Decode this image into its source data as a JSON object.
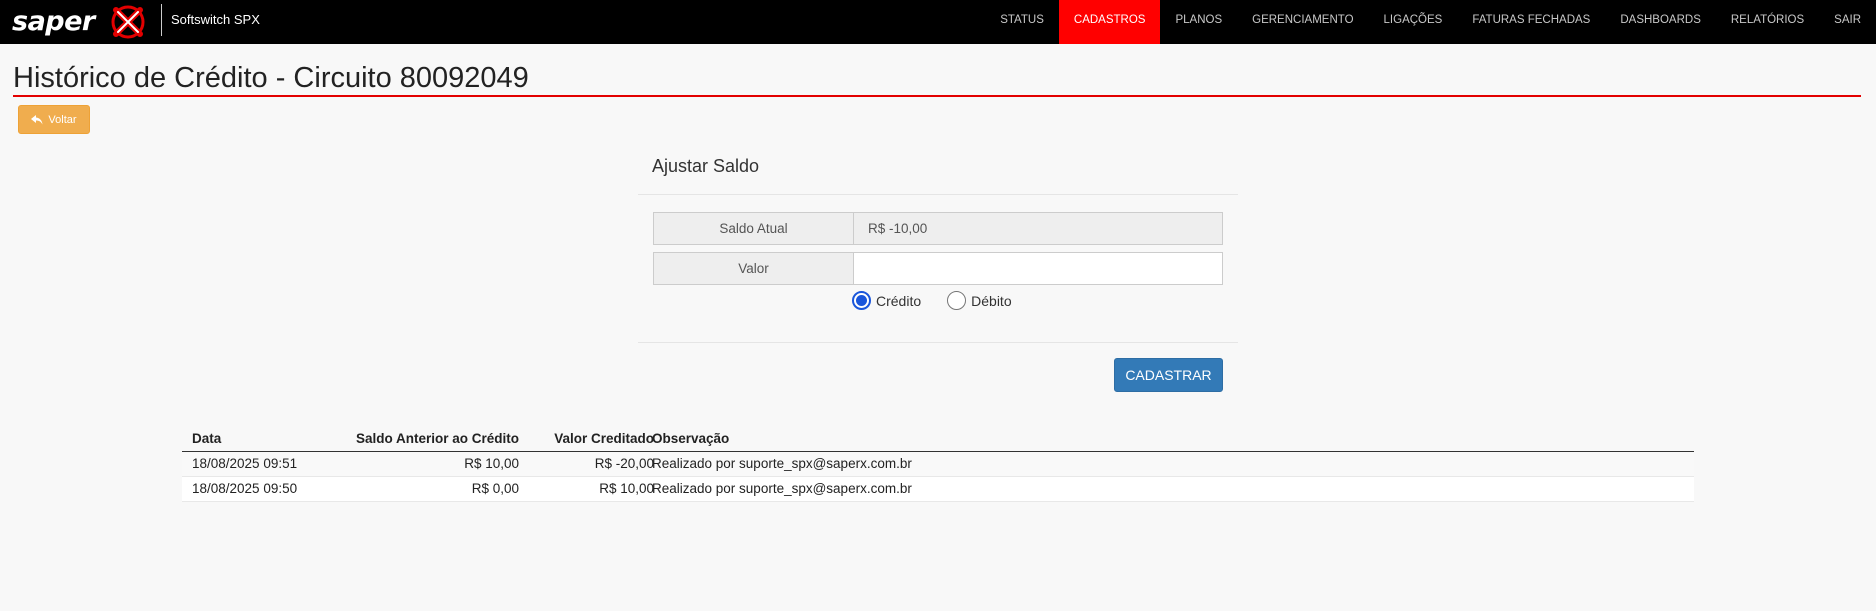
{
  "brand": {
    "logo_text": "saper",
    "subtitle": "Softswitch SPX",
    "accent_color": "#e30000"
  },
  "nav": {
    "items": [
      {
        "label": "STATUS",
        "active": false
      },
      {
        "label": "CADASTROS",
        "active": true
      },
      {
        "label": "PLANOS",
        "active": false
      },
      {
        "label": "GERENCIAMENTO",
        "active": false
      },
      {
        "label": "LIGAÇÕES",
        "active": false
      },
      {
        "label": "FATURAS FECHADAS",
        "active": false
      },
      {
        "label": "DASHBOARDS",
        "active": false
      },
      {
        "label": "RELATÓRIOS",
        "active": false
      },
      {
        "label": "SAIR",
        "active": false
      }
    ],
    "active_color": "#ff0000"
  },
  "page": {
    "title": "Histórico de Crédito - Circuito 80092049",
    "back_label": "Voltar",
    "back_icon": "reply-icon"
  },
  "form": {
    "title": "Ajustar Saldo",
    "balance_label": "Saldo Atual",
    "balance_value": "R$ -10,00",
    "amount_label": "Valor",
    "amount_value": "",
    "radio_credit": "Crédito",
    "radio_debit": "Débito",
    "selected": "credit",
    "submit_label": "CADASTRAR"
  },
  "history": {
    "columns": [
      "Data",
      "Saldo Anterior ao Crédito",
      "Valor Creditado",
      "Observação"
    ],
    "rows": [
      {
        "date": "18/08/2025 09:51",
        "previous": "R$ 10,00",
        "amount": "R$ -20,00",
        "note": "Realizado por suporte_spx@saperx.com.br"
      },
      {
        "date": "18/08/2025 09:50",
        "previous": "R$ 0,00",
        "amount": "R$ 10,00",
        "note": "Realizado por suporte_spx@saperx.com.br"
      }
    ]
  }
}
